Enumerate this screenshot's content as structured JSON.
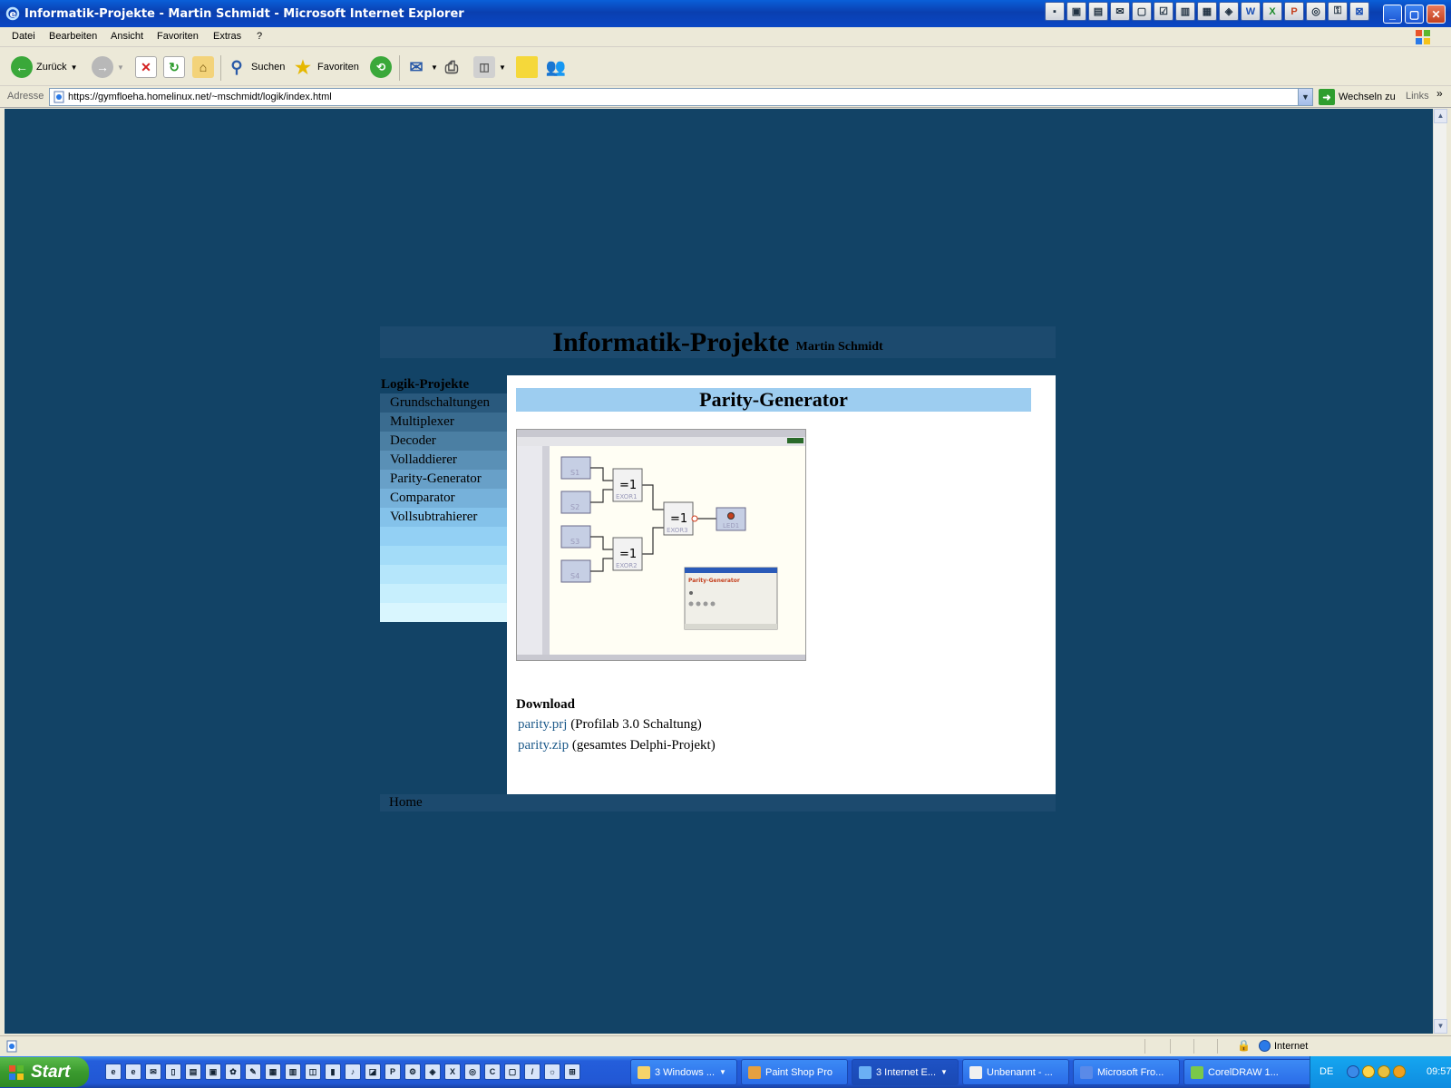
{
  "window": {
    "title": "Informatik-Projekte - Martin Schmidt - Microsoft Internet Explorer",
    "controls": [
      "minimize",
      "maximize",
      "close"
    ]
  },
  "quick_tray_icons": [
    "icon-1",
    "icon-2",
    "icon-3",
    "mail-icon",
    "icon-5",
    "icon-6",
    "icon-7",
    "icon-8",
    "icon-9",
    "word-icon",
    "excel-icon",
    "powerpoint-icon",
    "icon-13",
    "icon-14",
    "frontpage-icon"
  ],
  "menu": {
    "items": [
      "Datei",
      "Bearbeiten",
      "Ansicht",
      "Favoriten",
      "Extras",
      "?"
    ]
  },
  "toolbar": {
    "back_label": "Zurück",
    "search_label": "Suchen",
    "favorites_label": "Favoriten"
  },
  "address": {
    "label": "Adresse",
    "url": "https://gymfloeha.homelinux.net/~mschmidt/logik/index.html",
    "go_label": "Wechseln zu",
    "links_label": "Links"
  },
  "page": {
    "site_title": "Informatik-Projekte",
    "site_author": "Martin Schmidt",
    "sidebar": {
      "heading": "Logik-Projekte",
      "items": [
        "Grundschaltungen",
        "Multiplexer",
        "Decoder",
        "Volladdierer",
        "Parity-Generator",
        "Comparator",
        "Vollsubtrahierer"
      ]
    },
    "content_title": "Parity-Generator",
    "download": {
      "heading": "Download",
      "files": [
        {
          "link": "parity.prj",
          "desc": "(Profilab 3.0 Schaltung)"
        },
        {
          "link": "parity.zip",
          "desc": "(gesamtes Delphi-Projekt)"
        }
      ]
    },
    "footer_link": "Home"
  },
  "screenshot_image": {
    "switch_labels": [
      "S1",
      "S2",
      "S3",
      "S4"
    ],
    "gate_symbol": "=1",
    "gate_labels": [
      "EXOR1",
      "EXOR2",
      "EXOR3"
    ],
    "led_label": "LED1",
    "dialog_title": "Parity-Generator"
  },
  "status": {
    "zone": "Internet"
  },
  "taskbar": {
    "start_label": "Start",
    "tasks": [
      "3 Windows ...",
      "Paint Shop Pro",
      "3 Internet E...",
      "Unbenannt - ...",
      "Microsoft Fro...",
      "CorelDRAW 1..."
    ],
    "language": "DE",
    "clock": "09:57"
  },
  "colors": {
    "page_background": "#124366",
    "header_band": "#1c4a6e",
    "content_title_bg": "#9dcdf0",
    "link": "#1d5a8a"
  }
}
